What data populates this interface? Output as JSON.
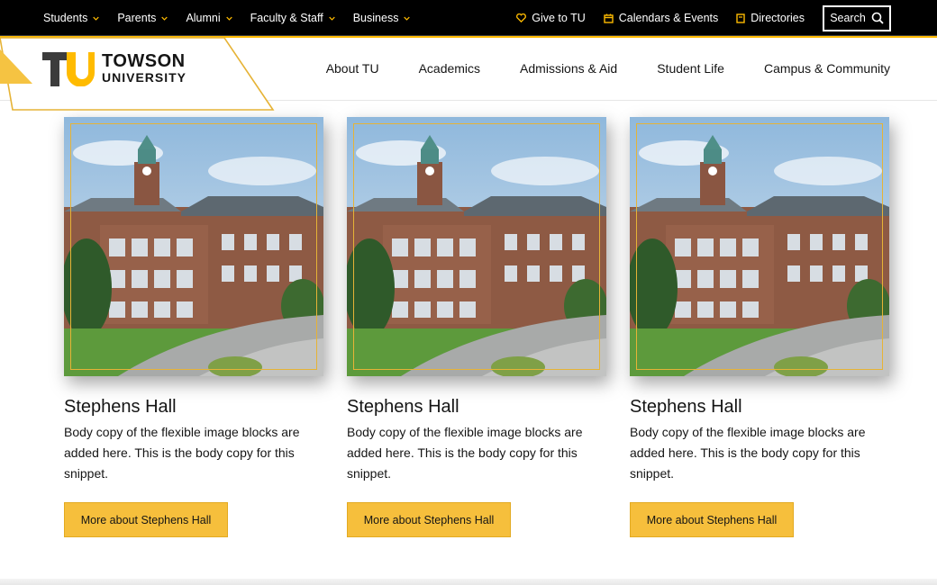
{
  "utility_bar": {
    "audience_menus": [
      "Students",
      "Parents",
      "Alumni",
      "Faculty & Staff",
      "Business"
    ],
    "links": [
      {
        "label": "Give to TU",
        "icon": "heart-icon"
      },
      {
        "label": "Calendars & Events",
        "icon": "calendar-icon"
      },
      {
        "label": "Directories",
        "icon": "book-icon"
      }
    ],
    "search_label": "Search"
  },
  "header": {
    "logo": {
      "mark": "TU",
      "name": "TOWSON",
      "subname": "UNIVERSITY"
    },
    "nav": [
      "About TU",
      "Academics",
      "Admissions & Aid",
      "Student Life",
      "Campus & Community"
    ]
  },
  "cards": [
    {
      "title": "Stephens Hall",
      "body": "Body copy of the flexible image blocks are added here. This is the body copy for this snippet.",
      "button": "More about Stephens Hall"
    },
    {
      "title": "Stephens Hall",
      "body": "Body copy of the flexible image blocks are added here. This is the body copy for this snippet.",
      "button": "More about Stephens Hall"
    },
    {
      "title": "Stephens Hall",
      "body": "Body copy of the flexible image blocks are added here. This is the body copy for this snippet.",
      "button": "More about Stephens Hall"
    }
  ],
  "colors": {
    "brand_gold": "#ffbb00",
    "button_gold": "#f6bf3c",
    "black": "#000000"
  }
}
